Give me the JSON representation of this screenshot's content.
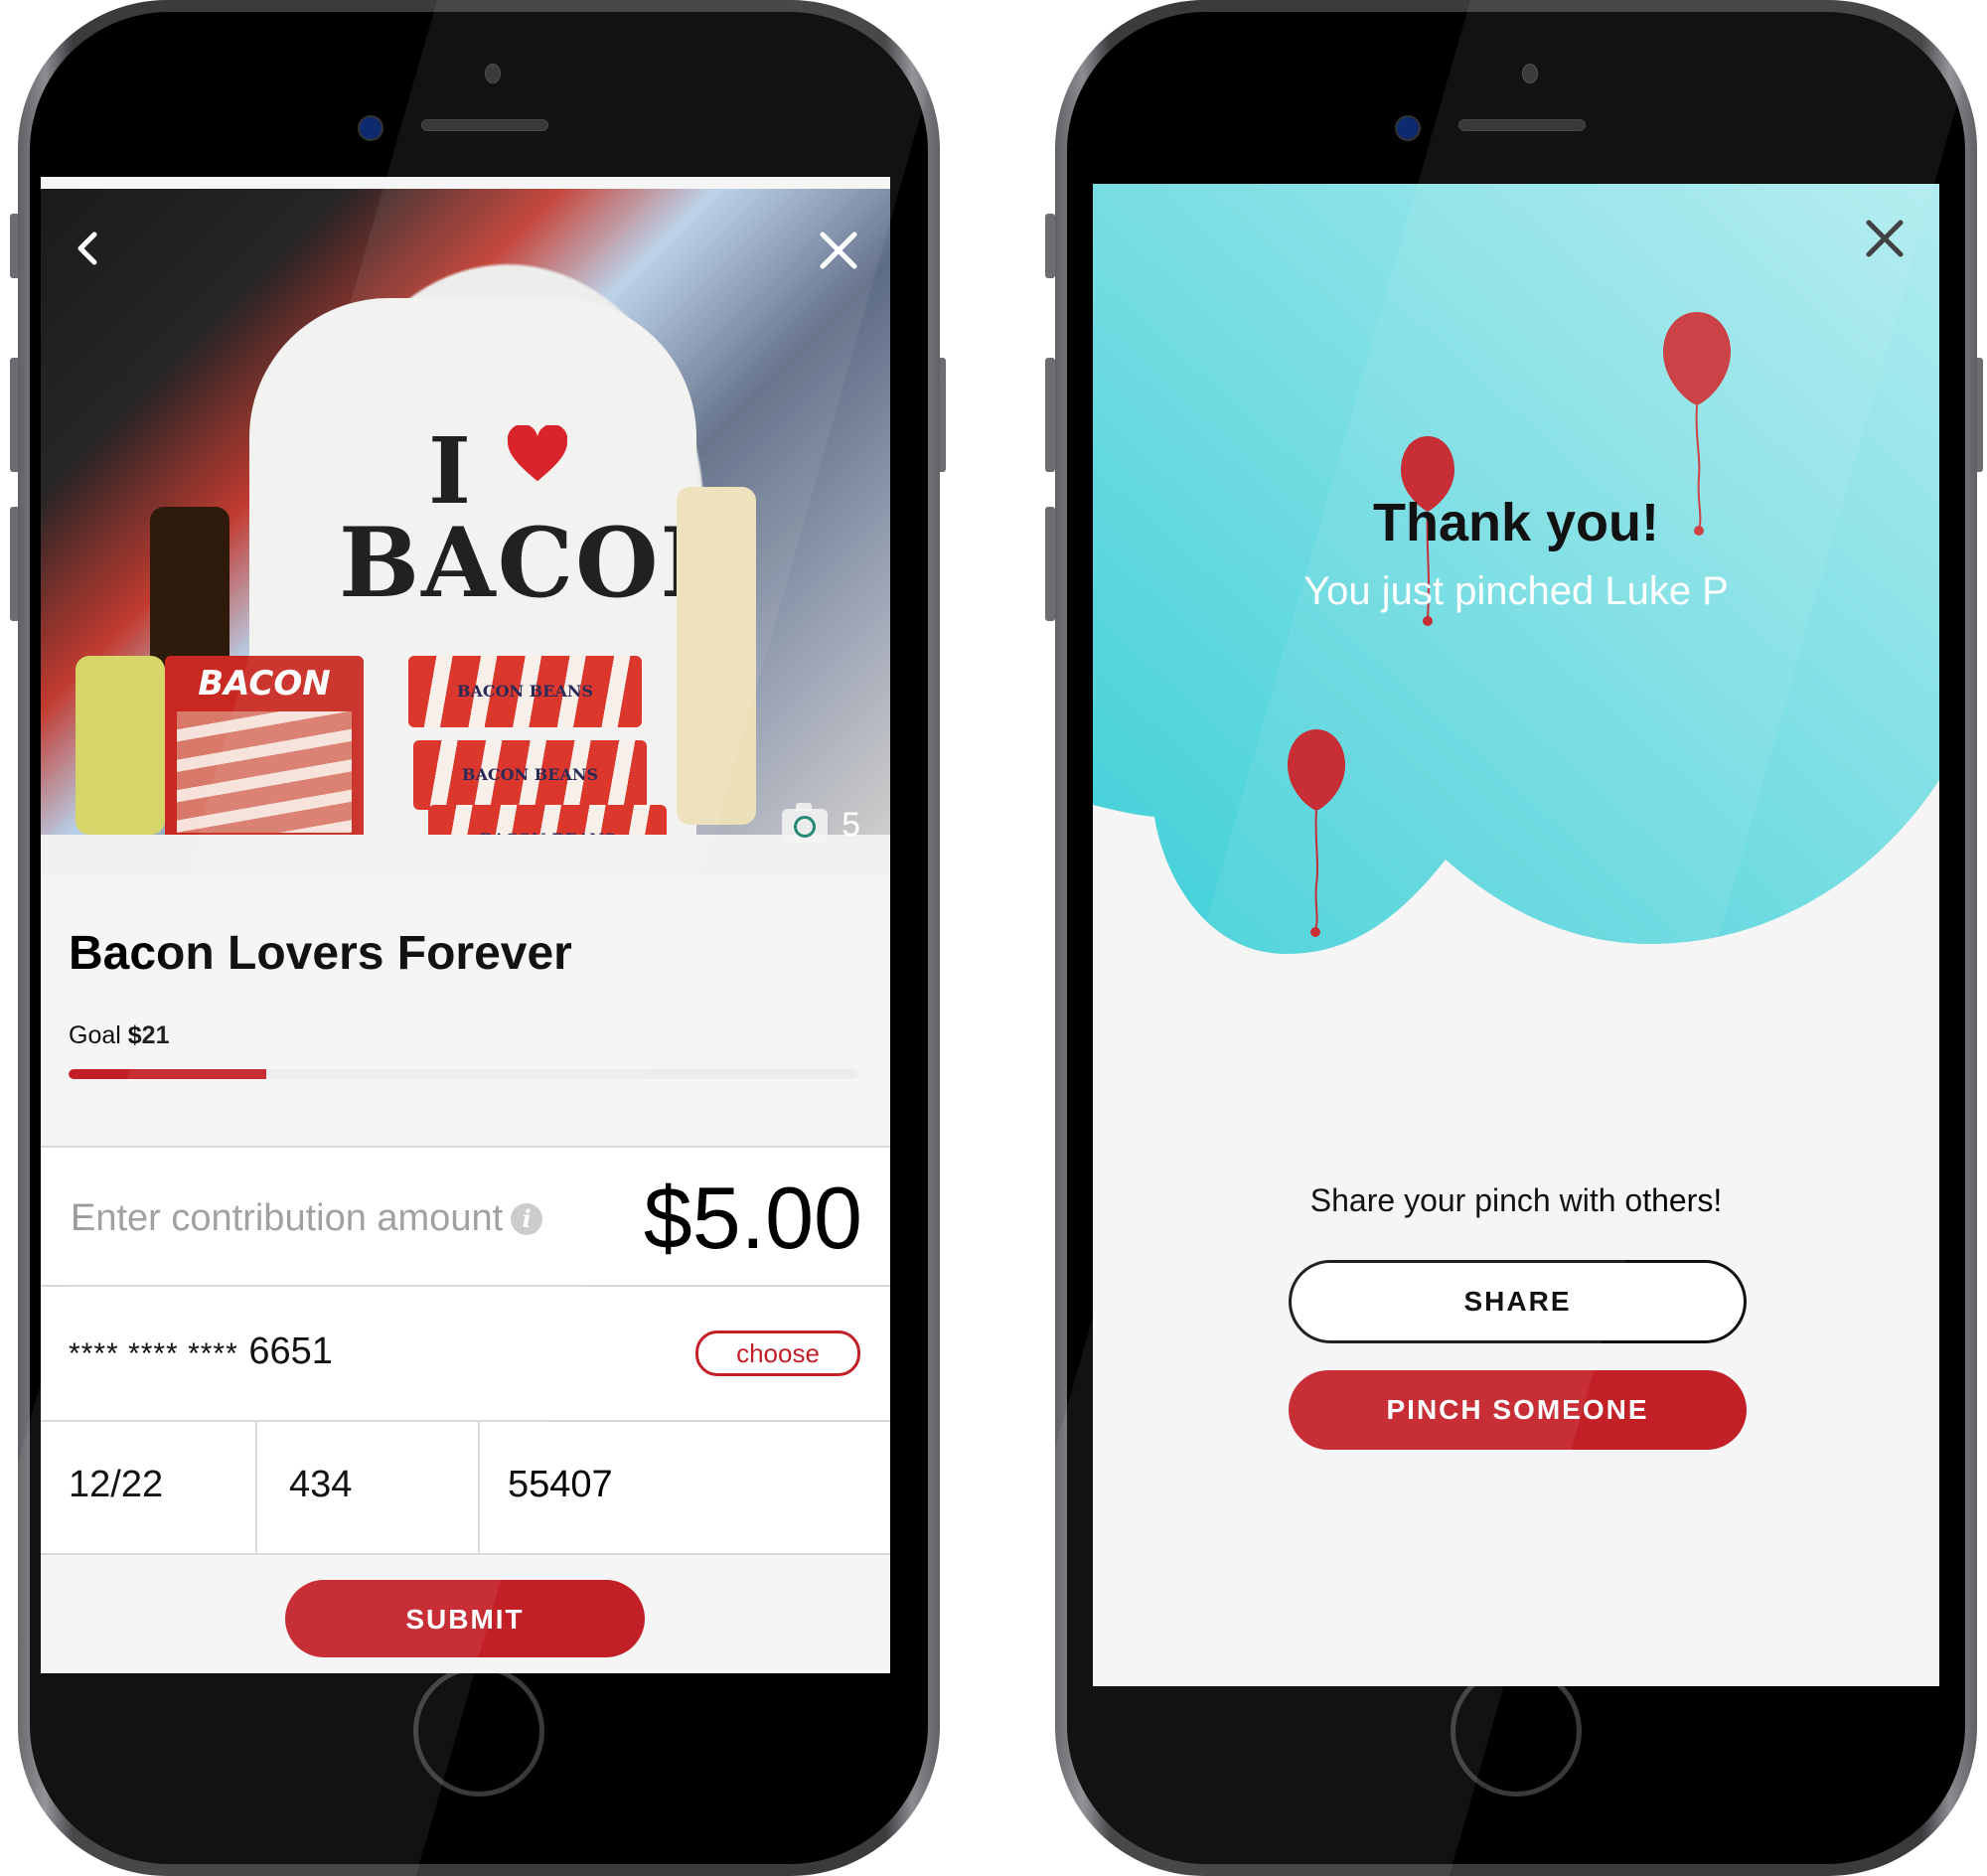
{
  "left_screen": {
    "photo": {
      "alt": "I ♥ BACON t-shirt with bacon products",
      "shirt_line1": "I",
      "shirt_line2": "BACON",
      "package_label": "BACON",
      "box_label": "BACON BEANS",
      "photo_count": "5"
    },
    "campaign": {
      "title": "Bacon Lovers Forever",
      "goal_label": "Goal",
      "goal_amount": "$21",
      "progress_fraction": 0.25
    },
    "contribution": {
      "label": "Enter contribution amount",
      "info_icon": "i",
      "amount": "$5.00"
    },
    "payment": {
      "card_mask": "**** **** ****",
      "card_last4": "6651",
      "choose_label": "choose",
      "expiry": "12/22",
      "cvv": "434",
      "zip": "55407"
    },
    "submit_label": "SUBMIT"
  },
  "right_screen": {
    "title": "Thank you!",
    "subtitle": "You just pinched Luke P",
    "share_prompt": "Share your pinch with others!",
    "share_label": "SHARE",
    "pinch_label": "PINCH SOMEONE"
  },
  "colors": {
    "brand_red": "#c31f27",
    "sky_top": "#b1ecef",
    "sky_bottom": "#3ecfd7",
    "background": "#f5f5f5"
  }
}
